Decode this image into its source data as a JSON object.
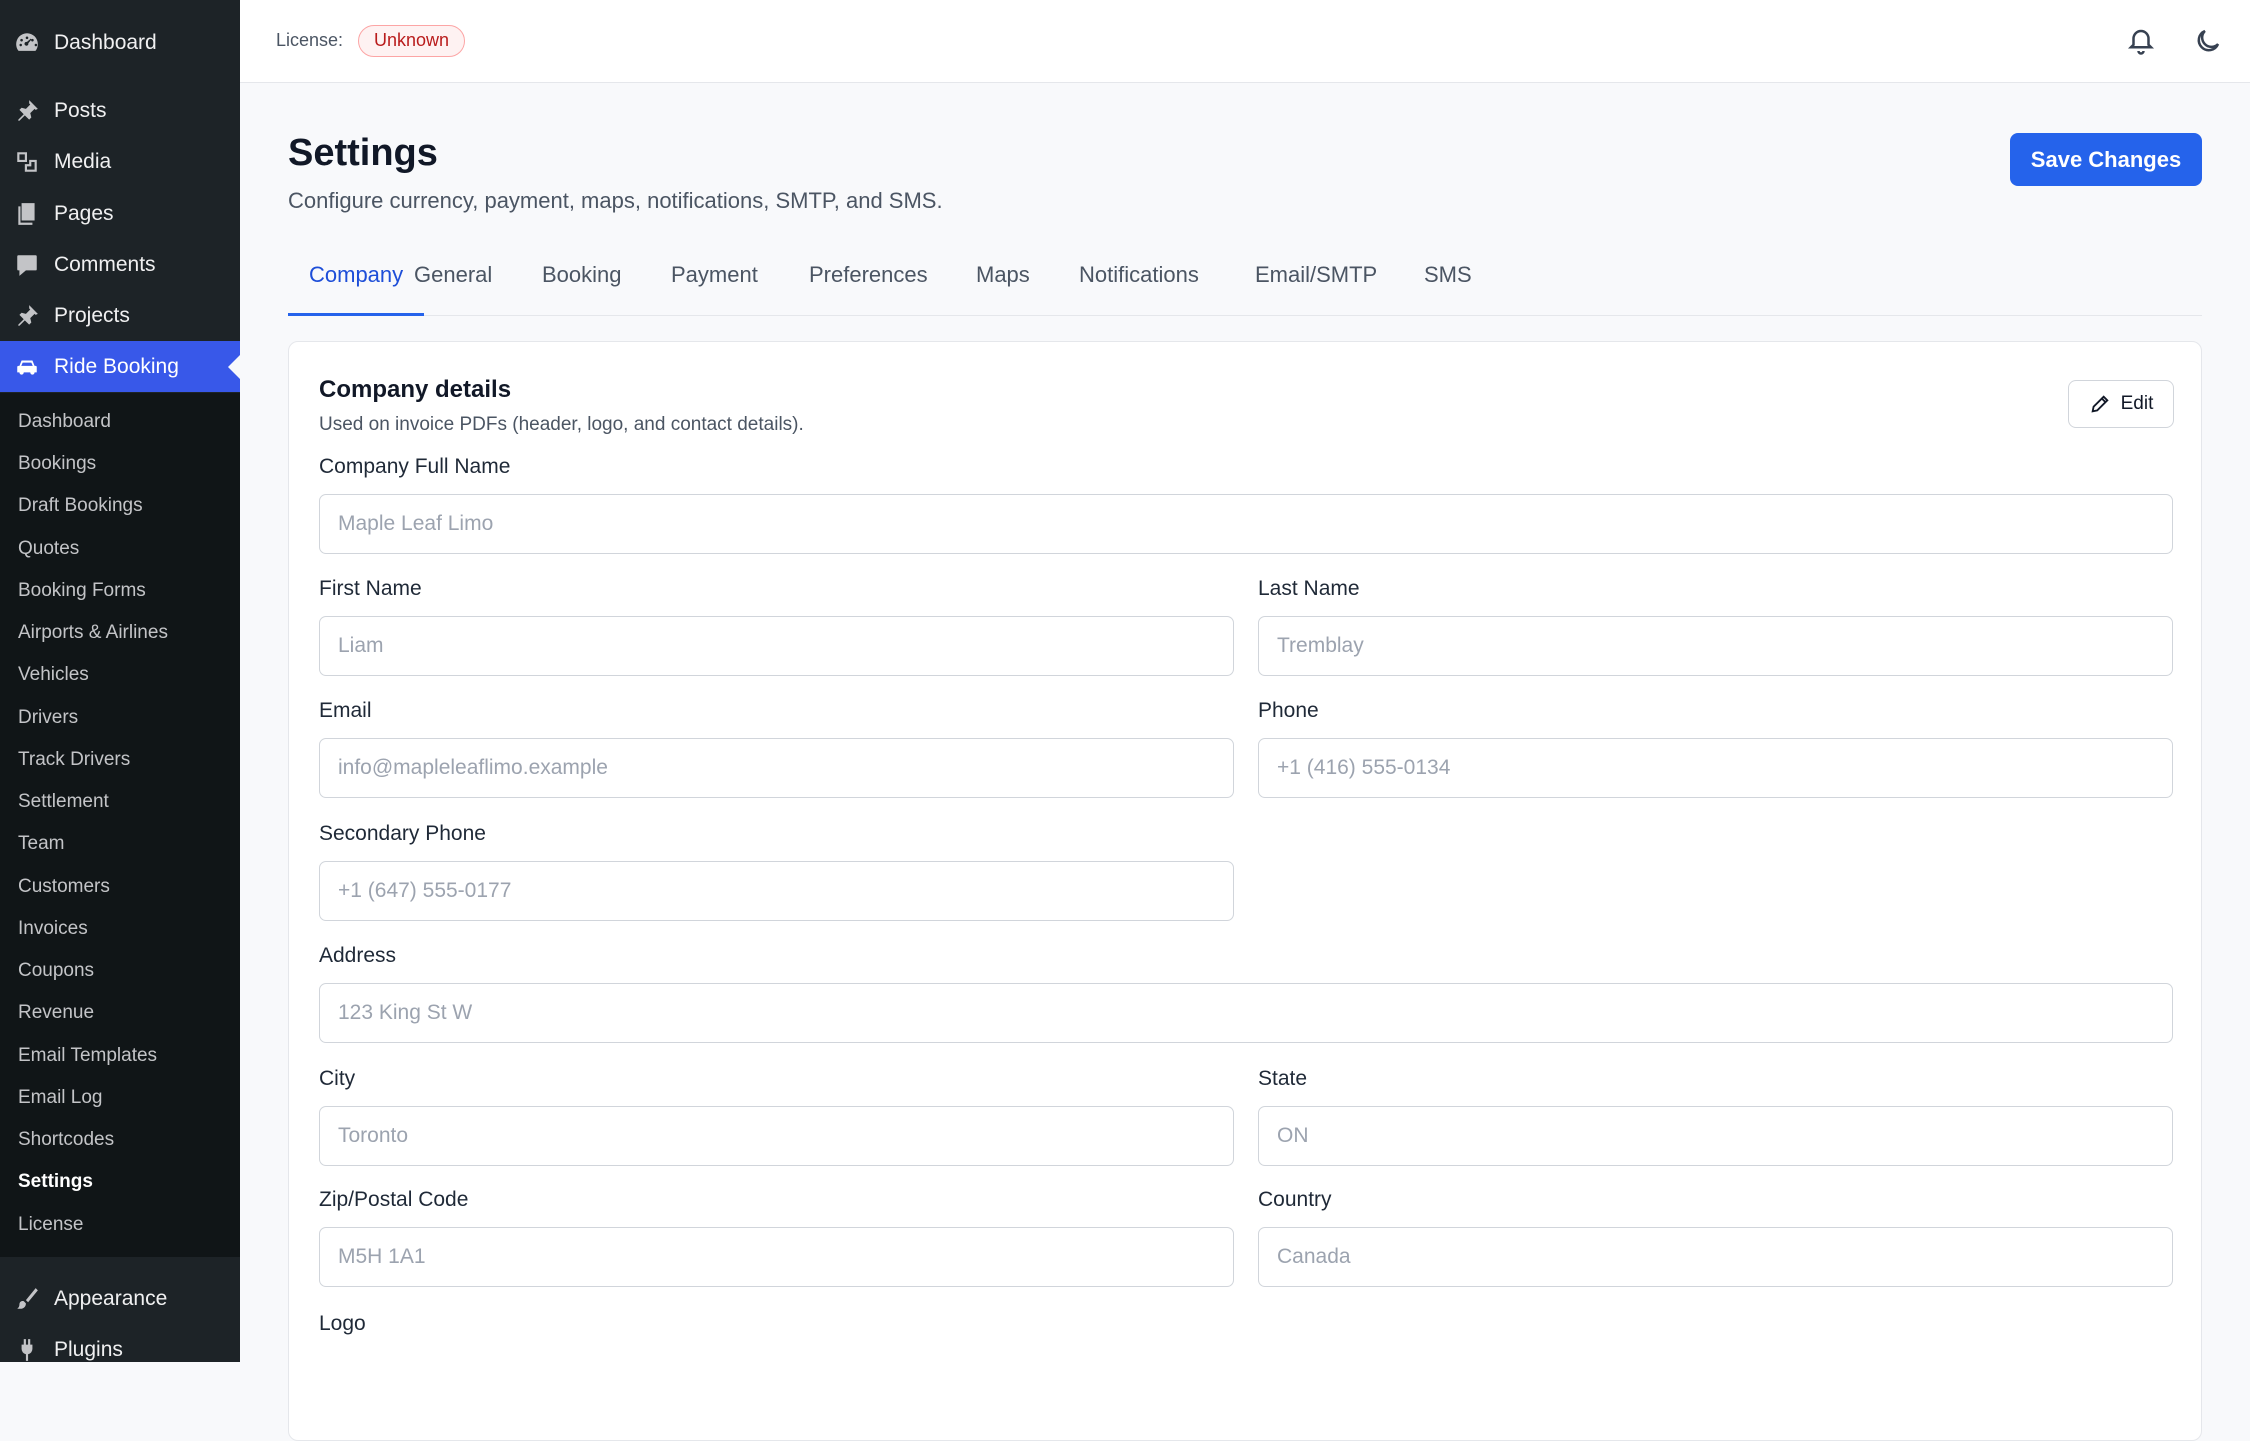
{
  "sidebar": {
    "top_item": "Dashboard",
    "items": [
      {
        "label": "Posts",
        "icon": "pin-icon"
      },
      {
        "label": "Media",
        "icon": "media-icon"
      },
      {
        "label": "Pages",
        "icon": "pages-icon"
      },
      {
        "label": "Comments",
        "icon": "comment-icon"
      },
      {
        "label": "Projects",
        "icon": "pin-icon"
      },
      {
        "label": "Ride Booking",
        "icon": "car-icon"
      }
    ],
    "submenu": [
      "Dashboard",
      "Bookings",
      "Draft Bookings",
      "Quotes",
      "Booking Forms",
      "Airports & Airlines",
      "Vehicles",
      "Drivers",
      "Track Drivers",
      "Settlement",
      "Team",
      "Customers",
      "Invoices",
      "Coupons",
      "Revenue",
      "Email Templates",
      "Email Log",
      "Shortcodes",
      "Settings",
      "License"
    ],
    "bottom_items": [
      {
        "label": "Appearance",
        "icon": "brush-icon"
      },
      {
        "label": "Plugins",
        "icon": "plug-icon"
      }
    ]
  },
  "topbar": {
    "license_label": "License:",
    "license_status": "Unknown"
  },
  "page": {
    "title": "Settings",
    "subtitle": "Configure currency, payment, maps, notifications, SMTP, and SMS.",
    "save_label": "Save Changes"
  },
  "tabs": [
    "Company",
    "General",
    "Booking",
    "Payment",
    "Preferences",
    "Maps",
    "Notifications",
    "Email/SMTP",
    "SMS"
  ],
  "card": {
    "title": "Company details",
    "subtitle": "Used on invoice PDFs (header, logo, and contact details).",
    "edit_label": "Edit"
  },
  "fields": {
    "company_full_name": {
      "label": "Company Full Name",
      "placeholder": "Maple Leaf Limo"
    },
    "first_name": {
      "label": "First Name",
      "placeholder": "Liam"
    },
    "last_name": {
      "label": "Last Name",
      "placeholder": "Tremblay"
    },
    "email": {
      "label": "Email",
      "placeholder": "info@mapleleaflimo.example"
    },
    "phone": {
      "label": "Phone",
      "placeholder": "+1 (416) 555-0134"
    },
    "secondary_phone": {
      "label": "Secondary Phone",
      "placeholder": "+1 (647) 555-0177"
    },
    "address": {
      "label": "Address",
      "placeholder": "123 King St W"
    },
    "city": {
      "label": "City",
      "placeholder": "Toronto"
    },
    "state": {
      "label": "State",
      "placeholder": "ON"
    },
    "zip": {
      "label": "Zip/Postal Code",
      "placeholder": "M5H 1A1"
    },
    "country": {
      "label": "Country",
      "placeholder": "Canada"
    },
    "logo": {
      "label": "Logo"
    }
  },
  "colors": {
    "accent": "#2563eb",
    "sidebar_bg": "#1d2327",
    "active_nav": "#3858e9",
    "badge_red": "#b91c1c"
  }
}
